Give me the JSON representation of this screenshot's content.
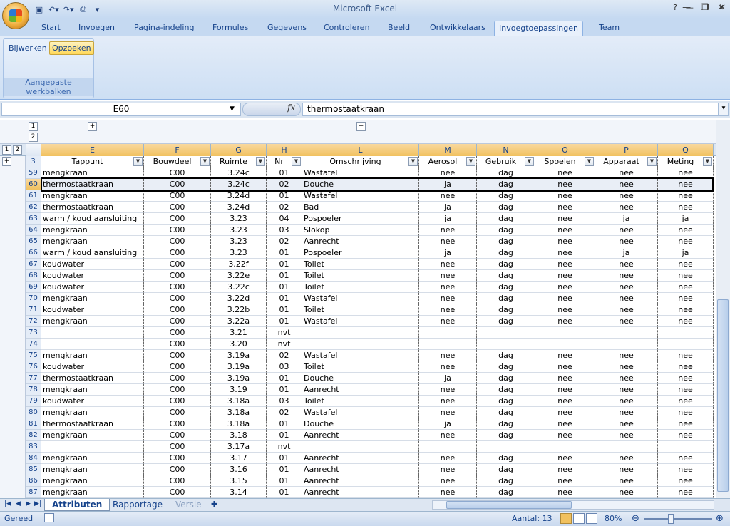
{
  "app": {
    "title": "Microsoft Excel",
    "qat": [
      "save-icon",
      "undo-icon",
      "redo-icon",
      "print-preview-icon"
    ]
  },
  "tabs": [
    "Start",
    "Invoegen",
    "Pagina-indeling",
    "Formules",
    "Gegevens",
    "Controleren",
    "Beeld",
    "Ontwikkelaars",
    "Invoegtoepassingen",
    "Team"
  ],
  "active_tab": "Invoegtoepassingen",
  "ribbon": {
    "btn1": "Bijwerken",
    "btn2": "Opzoeken",
    "group_label": "Aangepaste werkbalken"
  },
  "formula_bar": {
    "name_box": "E60",
    "fx": "fx",
    "value": "thermostaatkraan"
  },
  "outline": {
    "levels": [
      "1",
      "2"
    ],
    "row_levels": [
      "1",
      "2"
    ],
    "expand": "+",
    "row3": "3"
  },
  "columns": [
    {
      "letter": "E",
      "header": "Tappunt"
    },
    {
      "letter": "F",
      "header": "Bouwdeel"
    },
    {
      "letter": "G",
      "header": "Ruimte"
    },
    {
      "letter": "H",
      "header": "Nr"
    },
    {
      "letter": "L",
      "header": "Omschrijving"
    },
    {
      "letter": "M",
      "header": "Aerosol"
    },
    {
      "letter": "N",
      "header": "Gebruik"
    },
    {
      "letter": "O",
      "header": "Spoelen"
    },
    {
      "letter": "P",
      "header": "Apparaat"
    },
    {
      "letter": "Q",
      "header": "Meting"
    }
  ],
  "rows": [
    [
      "59",
      "mengkraan",
      "C00",
      "3.24c",
      "01",
      "Wastafel",
      "nee",
      "dag",
      "nee",
      "nee",
      "nee"
    ],
    [
      "60",
      "thermostaatkraan",
      "C00",
      "3.24c",
      "02",
      "Douche",
      "ja",
      "dag",
      "nee",
      "nee",
      "nee"
    ],
    [
      "61",
      "mengkraan",
      "C00",
      "3.24d",
      "01",
      "Wastafel",
      "nee",
      "dag",
      "nee",
      "nee",
      "nee"
    ],
    [
      "62",
      "thermostaatkraan",
      "C00",
      "3.24d",
      "02",
      "Bad",
      "ja",
      "dag",
      "nee",
      "nee",
      "nee"
    ],
    [
      "63",
      "warm / koud aansluiting",
      "C00",
      "3.23",
      "04",
      "Pospoeler",
      "ja",
      "dag",
      "nee",
      "ja",
      "ja"
    ],
    [
      "64",
      "mengkraan",
      "C00",
      "3.23",
      "03",
      "Slokop",
      "nee",
      "dag",
      "nee",
      "nee",
      "nee"
    ],
    [
      "65",
      "mengkraan",
      "C00",
      "3.23",
      "02",
      "Aanrecht",
      "nee",
      "dag",
      "nee",
      "nee",
      "nee"
    ],
    [
      "66",
      "warm / koud aansluiting",
      "C00",
      "3.23",
      "01",
      "Pospoeler",
      "ja",
      "dag",
      "nee",
      "ja",
      "ja"
    ],
    [
      "67",
      "koudwater",
      "C00",
      "3.22f",
      "01",
      "Toilet",
      "nee",
      "dag",
      "nee",
      "nee",
      "nee"
    ],
    [
      "68",
      "koudwater",
      "C00",
      "3.22e",
      "01",
      "Toilet",
      "nee",
      "dag",
      "nee",
      "nee",
      "nee"
    ],
    [
      "69",
      "koudwater",
      "C00",
      "3.22c",
      "01",
      "Toilet",
      "nee",
      "dag",
      "nee",
      "nee",
      "nee"
    ],
    [
      "70",
      "mengkraan",
      "C00",
      "3.22d",
      "01",
      "Wastafel",
      "nee",
      "dag",
      "nee",
      "nee",
      "nee"
    ],
    [
      "71",
      "koudwater",
      "C00",
      "3.22b",
      "01",
      "Toilet",
      "nee",
      "dag",
      "nee",
      "nee",
      "nee"
    ],
    [
      "72",
      "mengkraan",
      "C00",
      "3.22a",
      "01",
      "Wastafel",
      "nee",
      "dag",
      "nee",
      "nee",
      "nee"
    ],
    [
      "73",
      "",
      "C00",
      "3.21",
      "nvt",
      "",
      "",
      "",
      "",
      "",
      ""
    ],
    [
      "74",
      "",
      "C00",
      "3.20",
      "nvt",
      "",
      "",
      "",
      "",
      "",
      ""
    ],
    [
      "75",
      "mengkraan",
      "C00",
      "3.19a",
      "02",
      "Wastafel",
      "nee",
      "dag",
      "nee",
      "nee",
      "nee"
    ],
    [
      "76",
      "koudwater",
      "C00",
      "3.19a",
      "03",
      "Toilet",
      "nee",
      "dag",
      "nee",
      "nee",
      "nee"
    ],
    [
      "77",
      "thermostaatkraan",
      "C00",
      "3.19a",
      "01",
      "Douche",
      "ja",
      "dag",
      "nee",
      "nee",
      "nee"
    ],
    [
      "78",
      "mengkraan",
      "C00",
      "3.19",
      "01",
      "Aanrecht",
      "nee",
      "dag",
      "nee",
      "nee",
      "nee"
    ],
    [
      "79",
      "koudwater",
      "C00",
      "3.18a",
      "03",
      "Toilet",
      "nee",
      "dag",
      "nee",
      "nee",
      "nee"
    ],
    [
      "80",
      "mengkraan",
      "C00",
      "3.18a",
      "02",
      "Wastafel",
      "nee",
      "dag",
      "nee",
      "nee",
      "nee"
    ],
    [
      "81",
      "thermostaatkraan",
      "C00",
      "3.18a",
      "01",
      "Douche",
      "ja",
      "dag",
      "nee",
      "nee",
      "nee"
    ],
    [
      "82",
      "mengkraan",
      "C00",
      "3.18",
      "01",
      "Aanrecht",
      "nee",
      "dag",
      "nee",
      "nee",
      "nee"
    ],
    [
      "83",
      "",
      "C00",
      "3.17a",
      "nvt",
      "",
      "",
      "",
      "",
      "",
      ""
    ],
    [
      "84",
      "mengkraan",
      "C00",
      "3.17",
      "01",
      "Aanrecht",
      "nee",
      "dag",
      "nee",
      "nee",
      "nee"
    ],
    [
      "85",
      "mengkraan",
      "C00",
      "3.16",
      "01",
      "Aanrecht",
      "nee",
      "dag",
      "nee",
      "nee",
      "nee"
    ],
    [
      "86",
      "mengkraan",
      "C00",
      "3.15",
      "01",
      "Aanrecht",
      "nee",
      "dag",
      "nee",
      "nee",
      "nee"
    ],
    [
      "87",
      "mengkraan",
      "C00",
      "3.14",
      "01",
      "Aanrecht",
      "nee",
      "dag",
      "nee",
      "nee",
      "nee"
    ]
  ],
  "selected_row": "60",
  "sheets": [
    "Attributen",
    "Rapportage",
    "Versie"
  ],
  "active_sheet": "Attributen",
  "status": {
    "ready": "Gereed",
    "count": "Aantal: 13",
    "zoom": "80%"
  }
}
